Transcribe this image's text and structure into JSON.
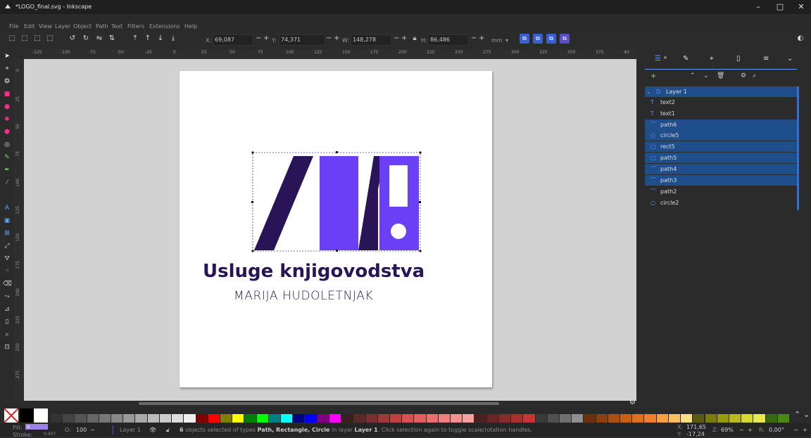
{
  "window": {
    "title": "*LOGO_final.svg - Inkscape",
    "minimize": "–",
    "maximize": "□",
    "close": "✕"
  },
  "menu": [
    "File",
    "Edit",
    "View",
    "Layer",
    "Object",
    "Path",
    "Text",
    "Filters",
    "Extensions",
    "Help"
  ],
  "toolbar": {
    "x_label": "X:",
    "x_value": "69,087",
    "y_label": "Y:",
    "y_value": "74,371",
    "w_label": "W:",
    "w_value": "148,278",
    "h_label": "H:",
    "h_value": "86,486",
    "unit": "mm",
    "minus": "−",
    "plus": "+"
  },
  "ruler_h": [
    "-125",
    "-100",
    "-75",
    "-50",
    "-25",
    "0",
    "25",
    "50",
    "75",
    "100",
    "125",
    "150",
    "175",
    "200",
    "225",
    "250",
    "275",
    "300",
    "325",
    "350",
    "375",
    "40"
  ],
  "ruler_v": [
    "0",
    "25",
    "50",
    "75",
    "100",
    "125",
    "150",
    "175",
    "200",
    "225",
    "250",
    "275"
  ],
  "canvas": {
    "logo_title": "Usluge knjigovodstva",
    "logo_subtitle": "MARIJA HUDOLETNJAK",
    "colors": {
      "dark": "#2a1458",
      "purple": "#6b3ff5",
      "page": "#ffffff"
    }
  },
  "layers_panel": {
    "tabs": [
      "layers",
      "xml",
      "objects",
      "document",
      "align",
      "more"
    ],
    "rows": [
      {
        "name": "Layer 1",
        "icon": "D",
        "selected": true,
        "is_layer": true
      },
      {
        "name": "text2",
        "icon": "T",
        "selected": false
      },
      {
        "name": "text1",
        "icon": "T",
        "selected": false
      },
      {
        "name": "path6",
        "icon": "⌒",
        "selected": true
      },
      {
        "name": "circle5",
        "icon": "○",
        "selected": true
      },
      {
        "name": "rect5",
        "icon": "□",
        "selected": true
      },
      {
        "name": "path5",
        "icon": "□",
        "selected": true
      },
      {
        "name": "path4",
        "icon": "⌒",
        "selected": true
      },
      {
        "name": "path3",
        "icon": "⌒",
        "selected": true
      },
      {
        "name": "path2",
        "icon": "⌒",
        "selected": false
      },
      {
        "name": "circle2",
        "icon": "○",
        "selected": false
      }
    ]
  },
  "status": {
    "fill_label": "Fill:",
    "fill_value": "a",
    "stroke_label": "Stroke:",
    "stroke_value": "0,007",
    "opacity_label": "O:",
    "opacity_value": "100",
    "layer": "Layer 1",
    "message_count": "6",
    "message_rest": " objects selected of types ",
    "message_types": "Path, Rectangle, Circle",
    "message_in": " in layer ",
    "message_layer": "Layer 1",
    "message_end": ". Click selection again to toggle scale/rotation handles.",
    "x_label": "X:",
    "x_value": "171,65",
    "y_label": "Y:",
    "y_value": "-17,24",
    "zoom_label": "Z:",
    "zoom_value": "69%",
    "rotate_label": "R:",
    "rotate_value": "0,00°"
  }
}
